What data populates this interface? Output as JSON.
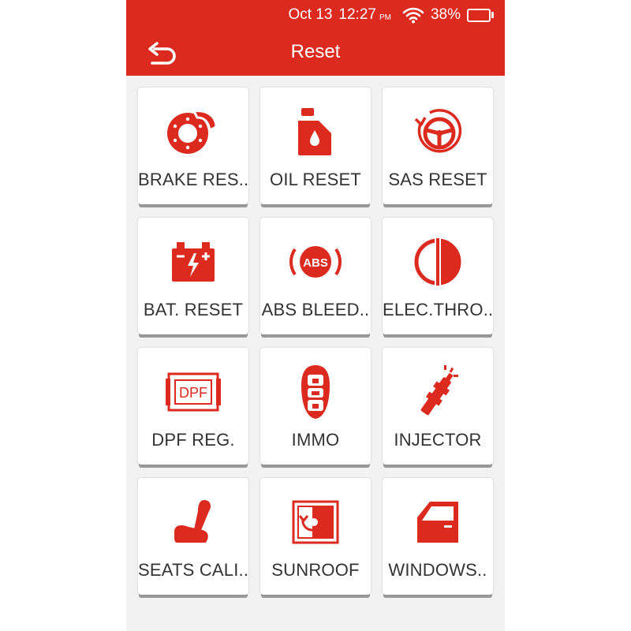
{
  "status": {
    "date": "Oct 13",
    "time": "12:27",
    "ampm": "PM",
    "battery_percent": "38%",
    "battery_level": 0.38
  },
  "header": {
    "title": "Reset",
    "back_icon": "back-arrow-icon"
  },
  "colors": {
    "accent": "#dc2a1f",
    "tile_background": "#ffffff",
    "background": "#f2f2f2",
    "label": "#333333"
  },
  "tiles": [
    {
      "label": "BRAKE RES..",
      "icon": "brake-pad-icon"
    },
    {
      "label": "OIL RESET",
      "icon": "oil-can-icon"
    },
    {
      "label": "SAS RESET",
      "icon": "steering-wheel-icon"
    },
    {
      "label": "BAT. RESET",
      "icon": "battery-icon"
    },
    {
      "label": "ABS BLEED..",
      "icon": "abs-icon"
    },
    {
      "label": "ELEC.THRO..",
      "icon": "throttle-icon"
    },
    {
      "label": "DPF REG.",
      "icon": "dpf-icon"
    },
    {
      "label": "IMMO",
      "icon": "key-fob-icon"
    },
    {
      "label": "INJECTOR",
      "icon": "injector-icon"
    },
    {
      "label": "SEATS CALI..",
      "icon": "seat-icon"
    },
    {
      "label": "SUNROOF",
      "icon": "sunroof-icon"
    },
    {
      "label": "WINDOWS..",
      "icon": "car-door-icon"
    }
  ],
  "icon_text": {
    "abs": "ABS",
    "dpf": "DPF"
  }
}
